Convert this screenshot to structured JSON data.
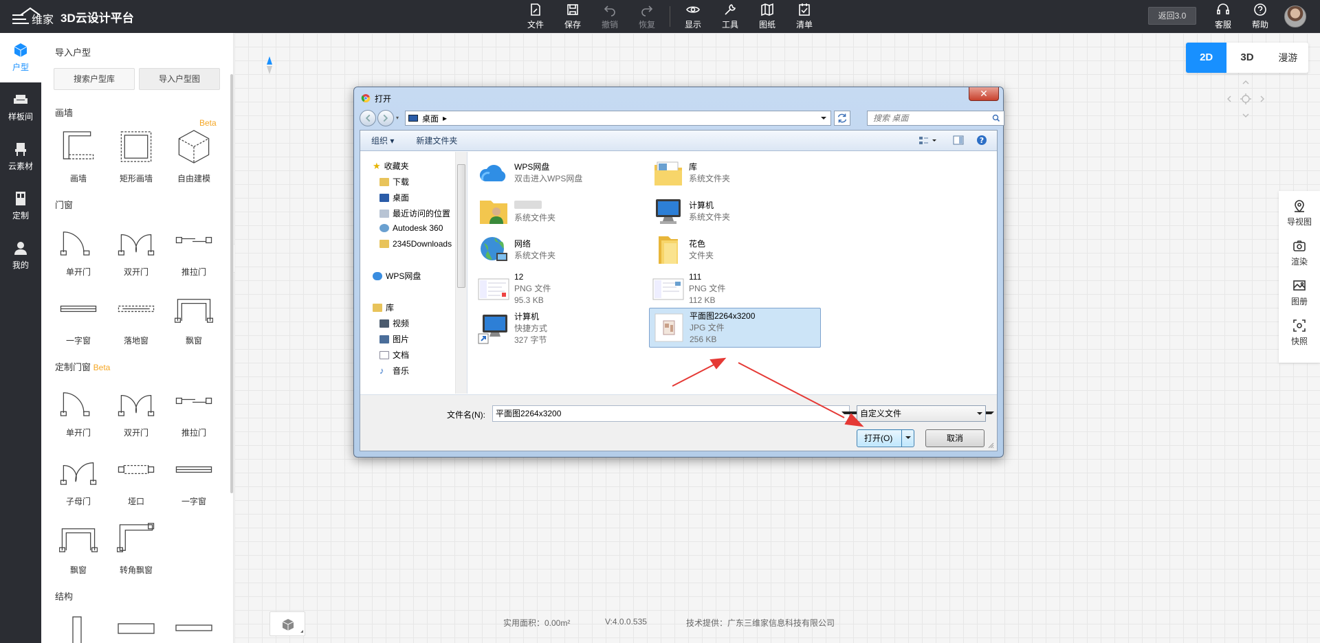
{
  "app": {
    "brand": "3D云设计平台",
    "back_label": "返回3.0"
  },
  "topmenu": [
    {
      "label": "文件",
      "icon": "file-icon",
      "enabled": true
    },
    {
      "label": "保存",
      "icon": "save-icon",
      "enabled": true
    },
    {
      "label": "撤销",
      "icon": "undo-icon",
      "enabled": false
    },
    {
      "label": "恢复",
      "icon": "redo-icon",
      "enabled": false
    },
    {
      "label": "显示",
      "icon": "eye-icon",
      "enabled": true
    },
    {
      "label": "工具",
      "icon": "wrench-icon",
      "enabled": true
    },
    {
      "label": "图纸",
      "icon": "map-icon",
      "enabled": true
    },
    {
      "label": "清单",
      "icon": "checklist-icon",
      "enabled": true
    }
  ],
  "topright": [
    {
      "label": "客服",
      "icon": "headset-icon"
    },
    {
      "label": "帮助",
      "icon": "help-icon"
    }
  ],
  "leftnav": [
    {
      "label": "户型",
      "icon": "house-cube-icon",
      "active": true
    },
    {
      "label": "样板间",
      "icon": "sofa-icon",
      "active": false
    },
    {
      "label": "云素材",
      "icon": "chair-icon",
      "active": false
    },
    {
      "label": "定制",
      "icon": "cabinet-icon",
      "active": false
    },
    {
      "label": "我的",
      "icon": "user-icon",
      "active": false
    }
  ],
  "panel": {
    "import_title": "导入户型",
    "search_btn": "搜索户型库",
    "import_btn": "导入户型图",
    "wall_title": "画墙",
    "beta": "Beta",
    "walls": [
      "画墙",
      "矩形画墙",
      "自由建模"
    ],
    "door_title": "门窗",
    "doors": [
      "单开门",
      "双开门",
      "推拉门",
      "一字窗",
      "落地窗",
      "飘窗"
    ],
    "custom_title": "定制门窗",
    "custom": [
      "单开门",
      "双开门",
      "推拉门",
      "子母门",
      "垭口",
      "一字窗",
      "飘窗",
      "转角飘窗"
    ],
    "struct_title": "结构"
  },
  "view": {
    "modes": [
      "2D",
      "3D",
      "漫游"
    ],
    "active": "2D"
  },
  "righttools": [
    {
      "label": "导视图",
      "icon": "map-pin-icon"
    },
    {
      "label": "渲染",
      "icon": "camera-icon"
    },
    {
      "label": "图册",
      "icon": "album-icon"
    },
    {
      "label": "快照",
      "icon": "snapshot-icon"
    }
  ],
  "footer": {
    "area": "实用面积：0.00m²",
    "version": "V:4.0.0.535",
    "provider": "技术提供：广东三维家信息科技有限公司"
  },
  "dialog": {
    "title": "打开",
    "address": "桌面",
    "search_placeholder": "搜索 桌面",
    "toolbar": {
      "organize": "组织 ▾",
      "new_folder": "新建文件夹"
    },
    "tree": {
      "favorites": "收藏夹",
      "downloads": "下载",
      "desktop": "桌面",
      "recent": "最近访问的位置",
      "autodesk": "Autodesk 360",
      "d2345": "2345Downloads",
      "wps": "WPS网盘",
      "library": "库",
      "video": "视频",
      "pictures": "图片",
      "docs": "文档",
      "music": "音乐"
    },
    "files": [
      {
        "name": "WPS网盘",
        "meta1": "双击进入WPS网盘",
        "meta2": "",
        "icon": "cloud-icon",
        "selected": false
      },
      {
        "name": "库",
        "meta1": "系统文件夹",
        "meta2": "",
        "icon": "library-folder-icon",
        "selected": false
      },
      {
        "name": "",
        "meta1": "系统文件夹",
        "meta2": "",
        "icon": "user-folder-icon",
        "selected": false
      },
      {
        "name": "计算机",
        "meta1": "系统文件夹",
        "meta2": "",
        "icon": "computer-icon",
        "selected": false
      },
      {
        "name": "网络",
        "meta1": "系统文件夹",
        "meta2": "",
        "icon": "network-icon",
        "selected": false
      },
      {
        "name": "花色",
        "meta1": "文件夹",
        "meta2": "",
        "icon": "folder-icon",
        "selected": false
      },
      {
        "name": "12",
        "meta1": "PNG 文件",
        "meta2": "95.3 KB",
        "icon": "png-thumb-icon",
        "selected": false
      },
      {
        "name": "111",
        "meta1": "PNG 文件",
        "meta2": "112 KB",
        "icon": "png-thumb-icon",
        "selected": false
      },
      {
        "name": "计算机",
        "meta1": "快捷方式",
        "meta2": "327 字节",
        "icon": "computer-shortcut-icon",
        "selected": false
      },
      {
        "name": "平面图2264x3200",
        "meta1": "JPG 文件",
        "meta2": "256 KB",
        "icon": "jpg-thumb-icon",
        "selected": true
      }
    ],
    "filename_label": "文件名(N):",
    "filename_value": "平面图2264x3200",
    "filetype": "自定义文件",
    "open_label": "打开(O)",
    "cancel_label": "取消"
  },
  "colors": {
    "accent": "#1890ff",
    "topbar": "#2b2d33",
    "beta": "#f5a623",
    "annotation_arrow": "#e53935"
  }
}
